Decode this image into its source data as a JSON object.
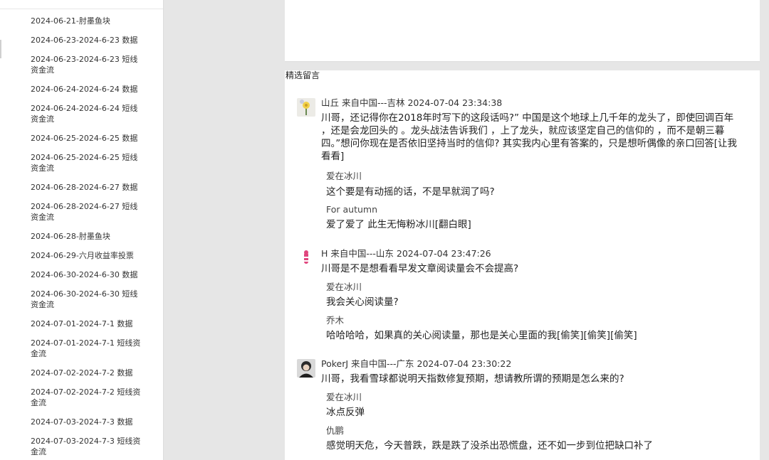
{
  "sidebar": {
    "items": [
      "2024-06-21-肘墨鱼块",
      "2024-06-23-2024-6-23 数据",
      "2024-06-23-2024-6-23 短线资金流",
      "2024-06-24-2024-6-24 数据",
      "2024-06-24-2024-6-24 短线资金流",
      "2024-06-25-2024-6-25 数据",
      "2024-06-25-2024-6-25 短线资金流",
      "2024-06-28-2024-6-27 数据",
      "2024-06-28-2024-6-27 短线资金流",
      "2024-06-28-肘墨鱼块",
      "2024-06-29-六月收益率投票",
      "2024-06-30-2024-6-30 数据",
      "2024-06-30-2024-6-30 短线资金流",
      "2024-07-01-2024-7-1 数据",
      "2024-07-01-2024-7-1 短线资金流",
      "2024-07-02-2024-7-2 数据",
      "2024-07-02-2024-7-2 短线资金流",
      "2024-07-03-2024-7-3 数据",
      "2024-07-03-2024-7-3 短线资金流"
    ]
  },
  "comments_section": {
    "title": "精选留言"
  },
  "comments": [
    {
      "meta": "山丘 来自中国---吉林 2024-07-04 23:34:38",
      "body": "川哥，还记得你在2018年时写下的这段话吗?” 中国是这个地球上几千年的龙头了，即使回调百年 ，还是会龙回头的 。龙头战法告诉我们 ，上了龙头，就应该坚定自己的信仰的 ，而不是朝三暮四。”想问你现在是否依旧坚持当时的信仰? 其实我内心里有答案的，只是想听偶像的亲口回答[让我看看]",
      "replies": [
        {
          "name": "爱在冰川",
          "text": "这个要是有动摇的话，不是早就润了吗?"
        },
        {
          "name": "For autumn",
          "text": "爱了爱了  此生无悔粉冰川[翻白眼]"
        }
      ]
    },
    {
      "meta": "H 来自中国---山东 2024-07-04 23:47:26",
      "body": "川哥是不是想看看早发文章阅读量会不会提高?",
      "replies": [
        {
          "name": "爱在冰川",
          "text": "我会关心阅读量?"
        },
        {
          "name": "乔木",
          "text": "哈哈哈哈，如果真的关心阅读量，那也是关心里面的我[偷笑][偷笑][偷笑]"
        }
      ]
    },
    {
      "meta": "PokerJ 来自中国---广东 2024-07-04 23:30:22",
      "body": "川哥，我看雪球都说明天指数修复预期，想请教所谓的预期是怎么来的?",
      "replies": [
        {
          "name": "爱在冰川",
          "text": "冰点反弹"
        },
        {
          "name": "仇鹏",
          "text": "感觉明天危，今天普跌，跌是跌了没杀出恐慌盘，还不如一步到位把缺口补了"
        }
      ]
    }
  ]
}
